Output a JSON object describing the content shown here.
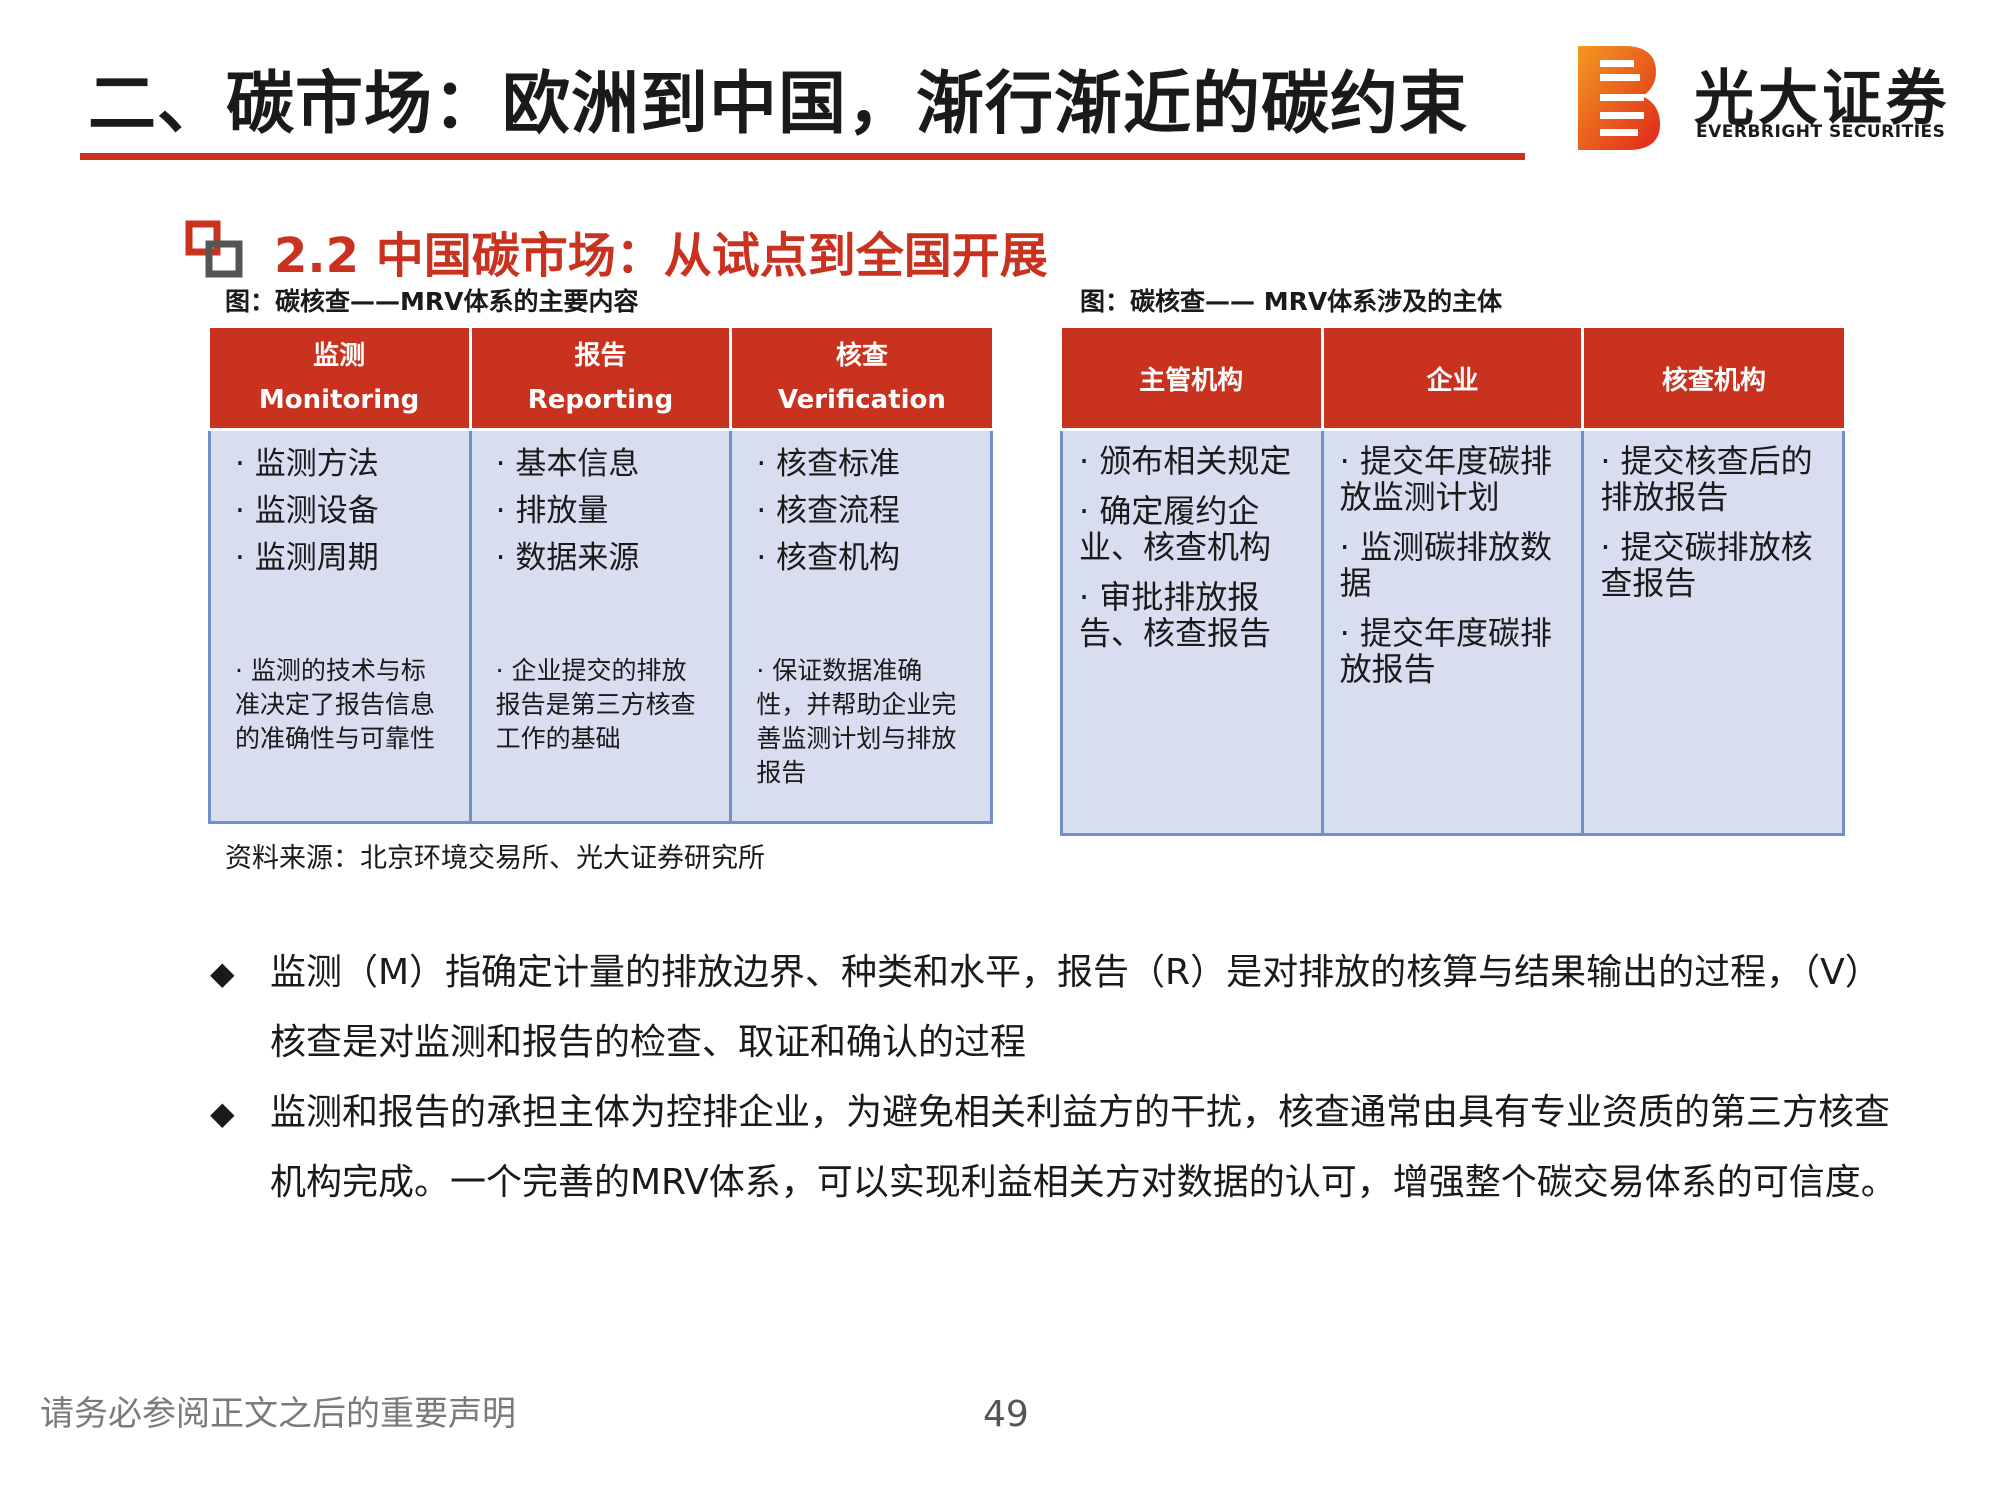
{
  "header": {
    "title": "二、碳市场：欧洲到中国，渐行渐近的碳约束",
    "logo_cn": "光大证券",
    "logo_en": "EVERBRIGHT SECURITIES"
  },
  "section": {
    "title": "2.2 中国碳市场：从试点到全国开展"
  },
  "left_table": {
    "caption": "图：碳核查——MRV体系的主要内容",
    "columns": [
      {
        "header_cn": "监测",
        "header_en": "Monitoring",
        "items": [
          "· 监测方法",
          "· 监测设备",
          "· 监测周期"
        ],
        "note": "· 监测的技术与标准决定了报告信息的准确性与可靠性"
      },
      {
        "header_cn": "报告",
        "header_en": "Reporting",
        "items": [
          "· 基本信息",
          "· 排放量",
          "· 数据来源"
        ],
        "note": "· 企业提交的排放报告是第三方核查工作的基础"
      },
      {
        "header_cn": "核查",
        "header_en": "Verification",
        "items": [
          "· 核查标准",
          "· 核查流程",
          "· 核查机构"
        ],
        "note": "· 保证数据准确性，并帮助企业完善监测计划与排放报告"
      }
    ]
  },
  "right_table": {
    "caption": "图：碳核查—— MRV体系涉及的主体",
    "columns": [
      {
        "header": "主管机构",
        "items": [
          "·  颁布相关规定",
          "·  确定履约企业、核查机构",
          "·  审批排放报告、核查报告"
        ]
      },
      {
        "header": "企业",
        "items": [
          "·  提交年度碳排放监测计划",
          "·   监测碳排放数据",
          "·  提交年度碳排放报告"
        ]
      },
      {
        "header": "核查机构",
        "items": [
          "·  提交核查后的排放报告",
          "·  提交碳排放核查报告"
        ]
      }
    ]
  },
  "source": "资料来源：北京环境交易所、光大证券研究所",
  "bullets": [
    "监测（M）指确定计量的排放边界、种类和水平，报告（R）是对排放的核算与结果输出的过程，（V）核查是对监测和报告的检查、取证和确认的过程",
    "监测和报告的承担主体为控排企业，为避免相关利益方的干扰，核查通常由具有专业资质的第三方核查机构完成。一个完善的MRV体系，可以实现利益相关方对数据的认可，增强整个碳交易体系的可信度。"
  ],
  "bullet_marker": "◆",
  "footer": {
    "disclaimer": "请务必参阅正文之后的重要声明",
    "page": "49"
  },
  "colors": {
    "accent": "#c8321f",
    "cell_fill": "#d8def0",
    "cell_border": "#6f93c8"
  }
}
